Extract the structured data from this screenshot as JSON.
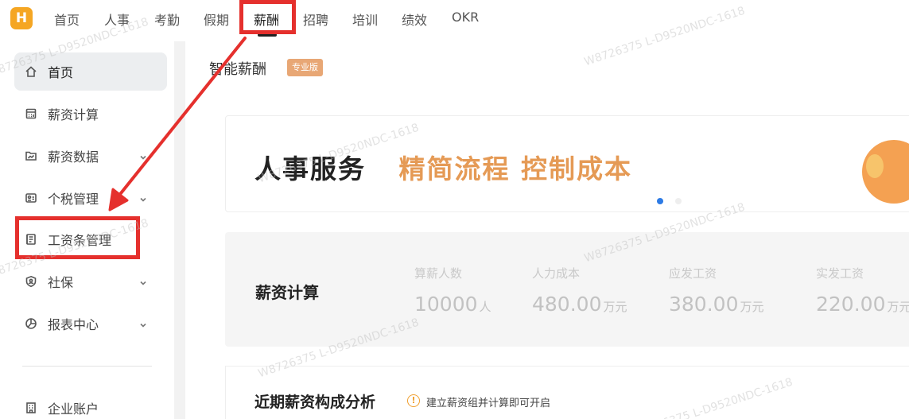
{
  "logo": {
    "letter": "H"
  },
  "topnav": {
    "items": [
      "首页",
      "人事",
      "考勤",
      "假期",
      "薪酬",
      "招聘",
      "培训",
      "绩效",
      "OKR"
    ],
    "active": "薪酬"
  },
  "sidebar": {
    "items": [
      {
        "label": "首页",
        "icon": "home-icon",
        "active": true
      },
      {
        "label": "薪资计算",
        "icon": "calculator-icon"
      },
      {
        "label": "薪资数据",
        "icon": "chart-folder-icon",
        "expandable": true
      },
      {
        "label": "个税管理",
        "icon": "tax-card-icon",
        "expandable": true
      },
      {
        "label": "工资条管理",
        "icon": "payslip-icon"
      },
      {
        "label": "社保",
        "icon": "shield-user-icon",
        "expandable": true
      },
      {
        "label": "报表中心",
        "icon": "pie-chart-icon",
        "expandable": true
      },
      {
        "label": "企业账户",
        "icon": "building-icon"
      }
    ]
  },
  "main": {
    "title": "智能薪酬",
    "badge": "专业版"
  },
  "banner": {
    "dark_text": "人事服务",
    "orange_text": "精简流程 控制成本"
  },
  "calc": {
    "title": "薪资计算",
    "stats": [
      {
        "label": "算薪人数",
        "value": "10000",
        "unit": "人"
      },
      {
        "label": "人力成本",
        "value": "480.00",
        "unit": "万元"
      },
      {
        "label": "应发工资",
        "value": "380.00",
        "unit": "万元"
      },
      {
        "label": "实发工资",
        "value": "220.00",
        "unit": "万元"
      }
    ]
  },
  "analysis": {
    "title": "近期薪资构成分析",
    "tip_icon": "!",
    "tip": "建立薪资组并计算即可开启"
  },
  "watermark": "W8726375 L-D9520NDC-1618",
  "colors": {
    "brand": "#f5a623",
    "accent_orange": "#e59a55",
    "annotation_red": "#e5302d",
    "active_dot": "#2d7be5"
  }
}
